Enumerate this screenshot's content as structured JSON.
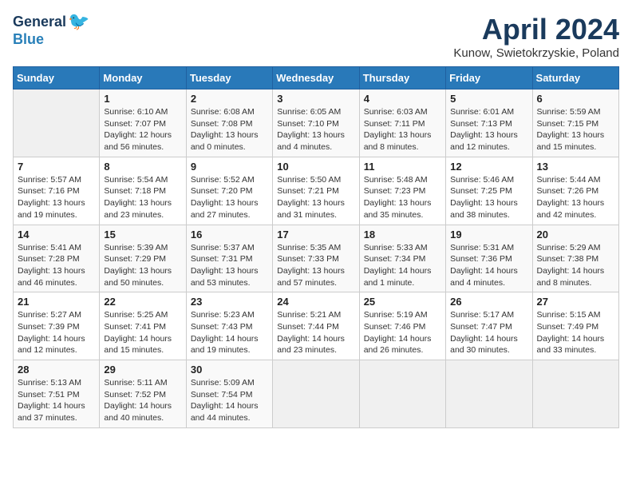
{
  "logo": {
    "line1": "General",
    "line2": "Blue"
  },
  "title": "April 2024",
  "subtitle": "Kunow, Swietokrzyskie, Poland",
  "days_of_week": [
    "Sunday",
    "Monday",
    "Tuesday",
    "Wednesday",
    "Thursday",
    "Friday",
    "Saturday"
  ],
  "weeks": [
    [
      {
        "day": "",
        "info": ""
      },
      {
        "day": "1",
        "info": "Sunrise: 6:10 AM\nSunset: 7:07 PM\nDaylight: 12 hours\nand 56 minutes."
      },
      {
        "day": "2",
        "info": "Sunrise: 6:08 AM\nSunset: 7:08 PM\nDaylight: 13 hours\nand 0 minutes."
      },
      {
        "day": "3",
        "info": "Sunrise: 6:05 AM\nSunset: 7:10 PM\nDaylight: 13 hours\nand 4 minutes."
      },
      {
        "day": "4",
        "info": "Sunrise: 6:03 AM\nSunset: 7:11 PM\nDaylight: 13 hours\nand 8 minutes."
      },
      {
        "day": "5",
        "info": "Sunrise: 6:01 AM\nSunset: 7:13 PM\nDaylight: 13 hours\nand 12 minutes."
      },
      {
        "day": "6",
        "info": "Sunrise: 5:59 AM\nSunset: 7:15 PM\nDaylight: 13 hours\nand 15 minutes."
      }
    ],
    [
      {
        "day": "7",
        "info": "Sunrise: 5:57 AM\nSunset: 7:16 PM\nDaylight: 13 hours\nand 19 minutes."
      },
      {
        "day": "8",
        "info": "Sunrise: 5:54 AM\nSunset: 7:18 PM\nDaylight: 13 hours\nand 23 minutes."
      },
      {
        "day": "9",
        "info": "Sunrise: 5:52 AM\nSunset: 7:20 PM\nDaylight: 13 hours\nand 27 minutes."
      },
      {
        "day": "10",
        "info": "Sunrise: 5:50 AM\nSunset: 7:21 PM\nDaylight: 13 hours\nand 31 minutes."
      },
      {
        "day": "11",
        "info": "Sunrise: 5:48 AM\nSunset: 7:23 PM\nDaylight: 13 hours\nand 35 minutes."
      },
      {
        "day": "12",
        "info": "Sunrise: 5:46 AM\nSunset: 7:25 PM\nDaylight: 13 hours\nand 38 minutes."
      },
      {
        "day": "13",
        "info": "Sunrise: 5:44 AM\nSunset: 7:26 PM\nDaylight: 13 hours\nand 42 minutes."
      }
    ],
    [
      {
        "day": "14",
        "info": "Sunrise: 5:41 AM\nSunset: 7:28 PM\nDaylight: 13 hours\nand 46 minutes."
      },
      {
        "day": "15",
        "info": "Sunrise: 5:39 AM\nSunset: 7:29 PM\nDaylight: 13 hours\nand 50 minutes."
      },
      {
        "day": "16",
        "info": "Sunrise: 5:37 AM\nSunset: 7:31 PM\nDaylight: 13 hours\nand 53 minutes."
      },
      {
        "day": "17",
        "info": "Sunrise: 5:35 AM\nSunset: 7:33 PM\nDaylight: 13 hours\nand 57 minutes."
      },
      {
        "day": "18",
        "info": "Sunrise: 5:33 AM\nSunset: 7:34 PM\nDaylight: 14 hours\nand 1 minute."
      },
      {
        "day": "19",
        "info": "Sunrise: 5:31 AM\nSunset: 7:36 PM\nDaylight: 14 hours\nand 4 minutes."
      },
      {
        "day": "20",
        "info": "Sunrise: 5:29 AM\nSunset: 7:38 PM\nDaylight: 14 hours\nand 8 minutes."
      }
    ],
    [
      {
        "day": "21",
        "info": "Sunrise: 5:27 AM\nSunset: 7:39 PM\nDaylight: 14 hours\nand 12 minutes."
      },
      {
        "day": "22",
        "info": "Sunrise: 5:25 AM\nSunset: 7:41 PM\nDaylight: 14 hours\nand 15 minutes."
      },
      {
        "day": "23",
        "info": "Sunrise: 5:23 AM\nSunset: 7:43 PM\nDaylight: 14 hours\nand 19 minutes."
      },
      {
        "day": "24",
        "info": "Sunrise: 5:21 AM\nSunset: 7:44 PM\nDaylight: 14 hours\nand 23 minutes."
      },
      {
        "day": "25",
        "info": "Sunrise: 5:19 AM\nSunset: 7:46 PM\nDaylight: 14 hours\nand 26 minutes."
      },
      {
        "day": "26",
        "info": "Sunrise: 5:17 AM\nSunset: 7:47 PM\nDaylight: 14 hours\nand 30 minutes."
      },
      {
        "day": "27",
        "info": "Sunrise: 5:15 AM\nSunset: 7:49 PM\nDaylight: 14 hours\nand 33 minutes."
      }
    ],
    [
      {
        "day": "28",
        "info": "Sunrise: 5:13 AM\nSunset: 7:51 PM\nDaylight: 14 hours\nand 37 minutes."
      },
      {
        "day": "29",
        "info": "Sunrise: 5:11 AM\nSunset: 7:52 PM\nDaylight: 14 hours\nand 40 minutes."
      },
      {
        "day": "30",
        "info": "Sunrise: 5:09 AM\nSunset: 7:54 PM\nDaylight: 14 hours\nand 44 minutes."
      },
      {
        "day": "",
        "info": ""
      },
      {
        "day": "",
        "info": ""
      },
      {
        "day": "",
        "info": ""
      },
      {
        "day": "",
        "info": ""
      }
    ]
  ]
}
